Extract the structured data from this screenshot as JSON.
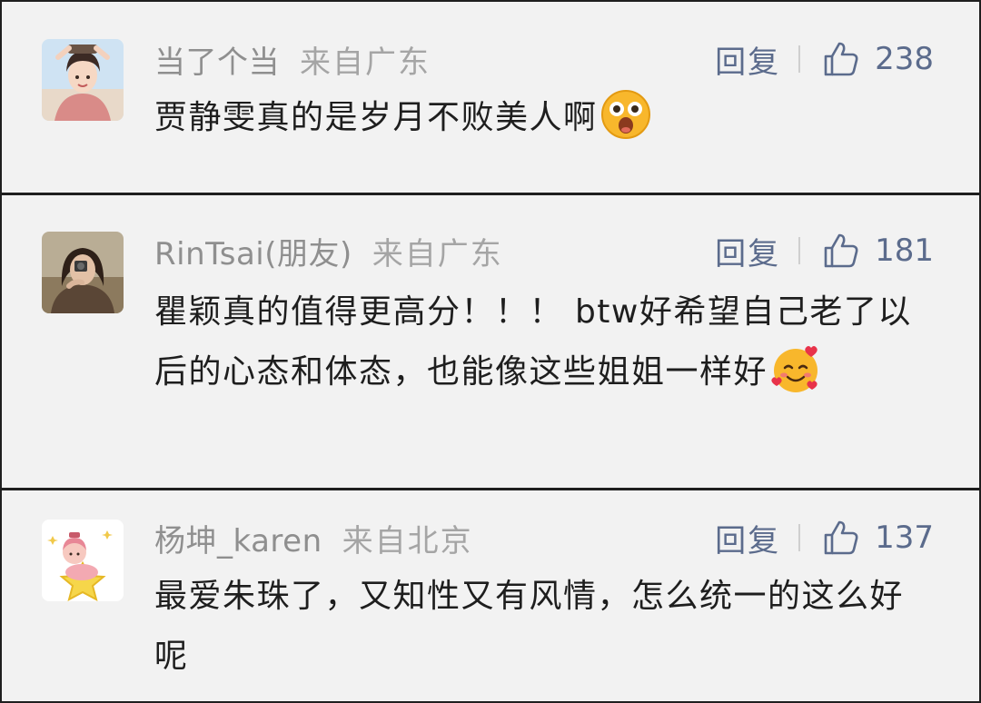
{
  "comments": [
    {
      "username": "当了个当",
      "location": "来自广东",
      "reply_label": "回复",
      "likes": "238",
      "text": "贾静雯真的是岁月不败美人啊",
      "avatar_icon": "girl-avatar-icon",
      "emoji_icon": "astonished-face-emoji"
    },
    {
      "username": "RinTsai(朋友)",
      "location": "来自广东",
      "reply_label": "回复",
      "likes": "181",
      "text": "瞿颖真的值得更高分！！！ btw好希望自己老了以后的心态和体态，也能像这些姐姐一样好",
      "avatar_icon": "woman-photo-avatar-icon",
      "emoji_icon": "smiling-face-with-hearts-emoji"
    },
    {
      "username": "杨坤_karen",
      "location": "来自北京",
      "reply_label": "回复",
      "likes": "137",
      "text": "最爱朱珠了，又知性又有风情，怎么统一的这么好呢",
      "avatar_icon": "baby-on-star-avatar-icon"
    }
  ],
  "colors": {
    "card_bg": "#f2f2f2",
    "divider": "#1f1f1f",
    "username": "#8f8f8f",
    "accent": "#5b6b8c",
    "text": "#1e1e1e"
  }
}
